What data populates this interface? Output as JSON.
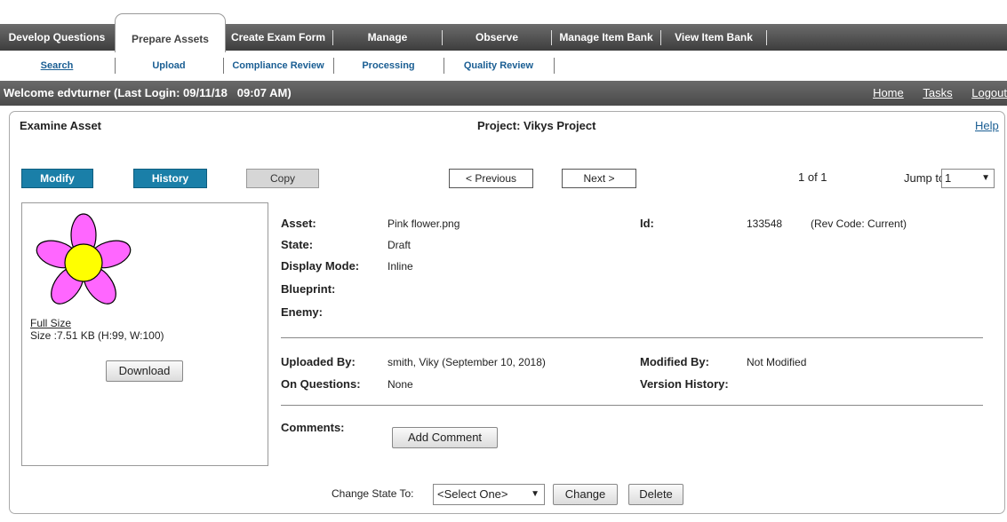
{
  "nav": {
    "tabs": [
      "Develop Questions",
      "Prepare Assets",
      "Create Exam Form",
      "Manage",
      "Observe",
      "Manage Item Bank",
      "View Item Bank"
    ],
    "active": "Prepare Assets"
  },
  "subnav": [
    "Search",
    "Upload",
    "Compliance Review",
    "Processing",
    "Quality Review"
  ],
  "welcome": {
    "text": "Welcome edvturner (Last Login: 09/11/18   09:07 AM)",
    "links": [
      "Home",
      "Tasks",
      "Logout"
    ]
  },
  "header": {
    "title": "Examine Asset",
    "project": "Project: Vikys Project",
    "help": "Help"
  },
  "toolbar": {
    "modify": "Modify",
    "history": "History",
    "copy": "Copy",
    "previous": "< Previous",
    "next": "Next >",
    "count": "1 of 1",
    "jump_label": "Jump to",
    "jump_value": "1"
  },
  "thumb": {
    "full_size": "Full Size",
    "size": "Size :7.51 KB (H:99, W:100)",
    "download": "Download"
  },
  "details": {
    "asset_label": "Asset:",
    "asset": "Pink flower.png",
    "state_label": "State:",
    "state": "Draft",
    "display_label": "Display Mode:",
    "display": "Inline",
    "blueprint_label": "Blueprint:",
    "enemy_label": "Enemy:",
    "id_label": "Id:",
    "id": "133548",
    "rev": "(Rev Code: Current)",
    "uploaded_label": "Uploaded By:",
    "uploaded": "smith, Viky (September 10, 2018)",
    "questions_label": "On Questions:",
    "questions": "None",
    "modified_label": "Modified By:",
    "modified": "Not Modified",
    "version_label": "Version History:",
    "comments_label": "Comments:",
    "add_comment": "Add Comment"
  },
  "footer": {
    "change_state_label": "Change State To:",
    "select_value": "<Select One>",
    "change": "Change",
    "delete": "Delete"
  },
  "colors": {
    "primary_button": "#1a7fa8",
    "nav_bg": "#4a4a4a",
    "link": "#1a5e93",
    "flower": "#ff66ff",
    "flower_center": "#ffff00"
  }
}
